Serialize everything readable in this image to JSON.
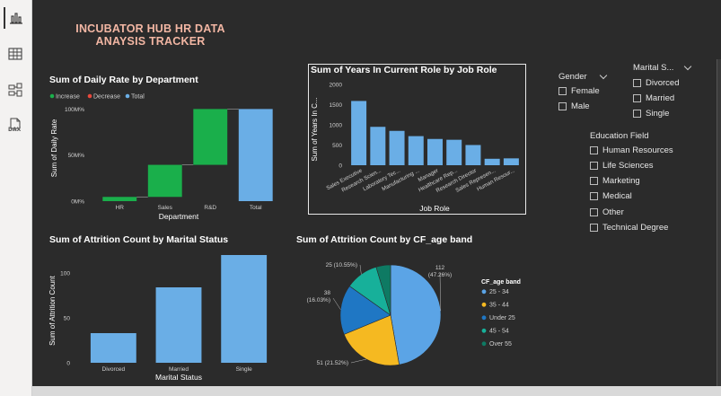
{
  "sidebar": {
    "items": [
      {
        "icon": "report-view-icon",
        "active": true
      },
      {
        "icon": "table-view-icon",
        "active": false
      },
      {
        "icon": "model-view-icon",
        "active": false
      },
      {
        "icon": "dax-query-icon",
        "active": false,
        "label": "DAX"
      }
    ]
  },
  "report": {
    "title_line1": "INCUBATOR HUB HR DATA",
    "title_line2": "ANAYSIS TRACKER"
  },
  "colors": {
    "increase": "#1aaf4b",
    "decrease": "#e8483c",
    "total": "#6aaee6",
    "bar": "#6aaee6",
    "title": "#f2b6a3",
    "pie_25_34": "#5ba4e6",
    "pie_35_44": "#f5b921",
    "pie_under_25": "#1f77c4",
    "pie_45_54": "#17b09a",
    "pie_over_55": "#0e7a63"
  },
  "chart_data": [
    {
      "id": "waterfall",
      "type": "bar",
      "subtype": "waterfall",
      "title": "Sum of Daily Rate by Department",
      "legend": [
        "Increase",
        "Decrease",
        "Total"
      ],
      "legend_position": "top-left",
      "categories": [
        "HR",
        "Sales",
        "R&D",
        "Total"
      ],
      "values": [
        4.6,
        34.8,
        60.6,
        100
      ],
      "kinds": [
        "increase",
        "increase",
        "increase",
        "total"
      ],
      "yticks": [
        "0M%",
        "50M%",
        "100M%"
      ],
      "ylim": [
        0,
        115
      ],
      "xlabel": "Department",
      "ylabel": "Sum of Daily Rate"
    },
    {
      "id": "years_role",
      "type": "bar",
      "title": "Sum of Years In Current Role by Job Role",
      "categories": [
        "Sales Executive",
        "Research Scien...",
        "Laboratory Tec...",
        "Manufacturing ...",
        "Manager",
        "Healthcare Rep...",
        "Research Director",
        "Sales Represen...",
        "Human Resour..."
      ],
      "values": [
        1590,
        950,
        850,
        720,
        650,
        630,
        500,
        160,
        170
      ],
      "yticks": [
        "0",
        "500",
        "1000",
        "1500",
        "2000"
      ],
      "ylim": [
        0,
        2000
      ],
      "xlabel": "Job Role",
      "ylabel": "Sum of Years In C..."
    },
    {
      "id": "attrition_marital",
      "type": "bar",
      "title": "Sum of Attrition Count by Marital Status",
      "categories": [
        "Divorced",
        "Married",
        "Single"
      ],
      "values": [
        33,
        84,
        120
      ],
      "yticks": [
        "0",
        "50",
        "100"
      ],
      "ylim": [
        0,
        125
      ],
      "xlabel": "Marital Status",
      "ylabel": "Sum of Attrition Count"
    },
    {
      "id": "attrition_age",
      "type": "pie",
      "title": "Sum of Attrition Count by CF_age band",
      "legend_title": "CF_age band",
      "legend_position": "right",
      "labels": [
        "25 - 34",
        "35 - 44",
        "Under 25",
        "45 - 54",
        "Over 55"
      ],
      "values": [
        112,
        51,
        38,
        25,
        11
      ],
      "data_labels": [
        "112\n(47.26%)",
        "51 (21.52%)",
        "38\n(16.03%)",
        "25 (10.55%)",
        ""
      ]
    }
  ],
  "slicers": {
    "gender": {
      "title": "Gender",
      "items": [
        "Female",
        "Male"
      ]
    },
    "marital": {
      "title": "Marital S...",
      "items": [
        "Divorced",
        "Married",
        "Single"
      ]
    },
    "education": {
      "title": "Education Field",
      "items": [
        "Human Resources",
        "Life Sciences",
        "Marketing",
        "Medical",
        "Other",
        "Technical Degree"
      ]
    }
  }
}
